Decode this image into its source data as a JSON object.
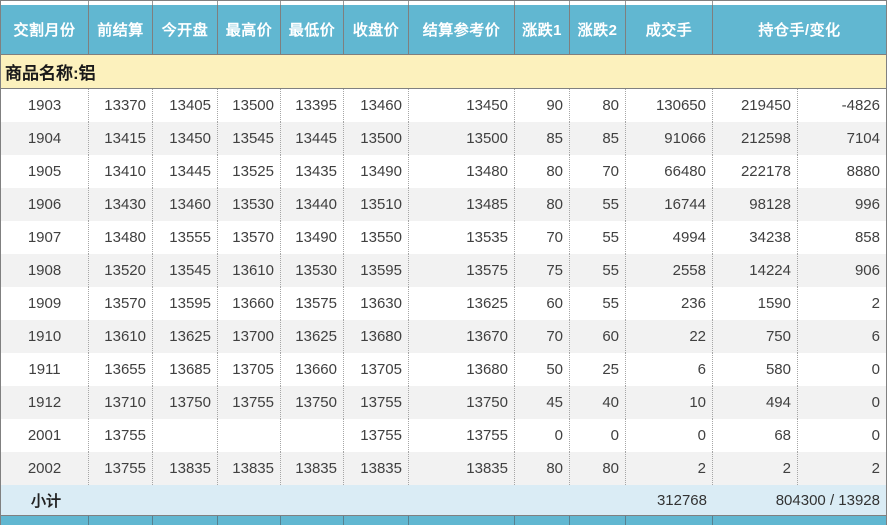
{
  "table": {
    "headers": [
      "交割月份",
      "前结算",
      "今开盘",
      "最高价",
      "最低价",
      "收盘价",
      "结算参考价",
      "涨跌1",
      "涨跌2",
      "成交手",
      "持仓手/变化"
    ],
    "column_keys": [
      "month",
      "prev-settlement",
      "open",
      "high",
      "low",
      "close",
      "settlement-ref",
      "change1",
      "change2",
      "volume",
      "open-interest",
      "oi-change"
    ],
    "product_label": "商品名称:铝",
    "rows": [
      [
        "1903",
        "13370",
        "13405",
        "13500",
        "13395",
        "13460",
        "13450",
        "90",
        "80",
        "130650",
        "219450",
        "-4826"
      ],
      [
        "1904",
        "13415",
        "13450",
        "13545",
        "13445",
        "13500",
        "13500",
        "85",
        "85",
        "91066",
        "212598",
        "7104"
      ],
      [
        "1905",
        "13410",
        "13445",
        "13525",
        "13435",
        "13490",
        "13480",
        "80",
        "70",
        "66480",
        "222178",
        "8880"
      ],
      [
        "1906",
        "13430",
        "13460",
        "13530",
        "13440",
        "13510",
        "13485",
        "80",
        "55",
        "16744",
        "98128",
        "996"
      ],
      [
        "1907",
        "13480",
        "13555",
        "13570",
        "13490",
        "13550",
        "13535",
        "70",
        "55",
        "4994",
        "34238",
        "858"
      ],
      [
        "1908",
        "13520",
        "13545",
        "13610",
        "13530",
        "13595",
        "13575",
        "75",
        "55",
        "2558",
        "14224",
        "906"
      ],
      [
        "1909",
        "13570",
        "13595",
        "13660",
        "13575",
        "13630",
        "13625",
        "60",
        "55",
        "236",
        "1590",
        "2"
      ],
      [
        "1910",
        "13610",
        "13625",
        "13700",
        "13625",
        "13680",
        "13670",
        "70",
        "60",
        "22",
        "750",
        "6"
      ],
      [
        "1911",
        "13655",
        "13685",
        "13705",
        "13660",
        "13705",
        "13680",
        "50",
        "25",
        "6",
        "580",
        "0"
      ],
      [
        "1912",
        "13710",
        "13750",
        "13755",
        "13750",
        "13755",
        "13750",
        "45",
        "40",
        "10",
        "494",
        "0"
      ],
      [
        "2001",
        "13755",
        "",
        "",
        "",
        "13755",
        "13755",
        "0",
        "0",
        "0",
        "68",
        "0"
      ],
      [
        "2002",
        "13755",
        "13835",
        "13835",
        "13835",
        "13835",
        "13835",
        "80",
        "80",
        "2",
        "2",
        "2"
      ]
    ],
    "subtotal": {
      "label": "小计",
      "volume_total": "312768",
      "open_interest_total": "804300 / 13928"
    }
  },
  "colors": {
    "header_bg": "#61B7D1",
    "product_row_bg": "#FCF1BD",
    "subtotal_bg": "#DAECF5",
    "alt_row_bg": "#F2F2F2",
    "data_text": "#404040"
  }
}
